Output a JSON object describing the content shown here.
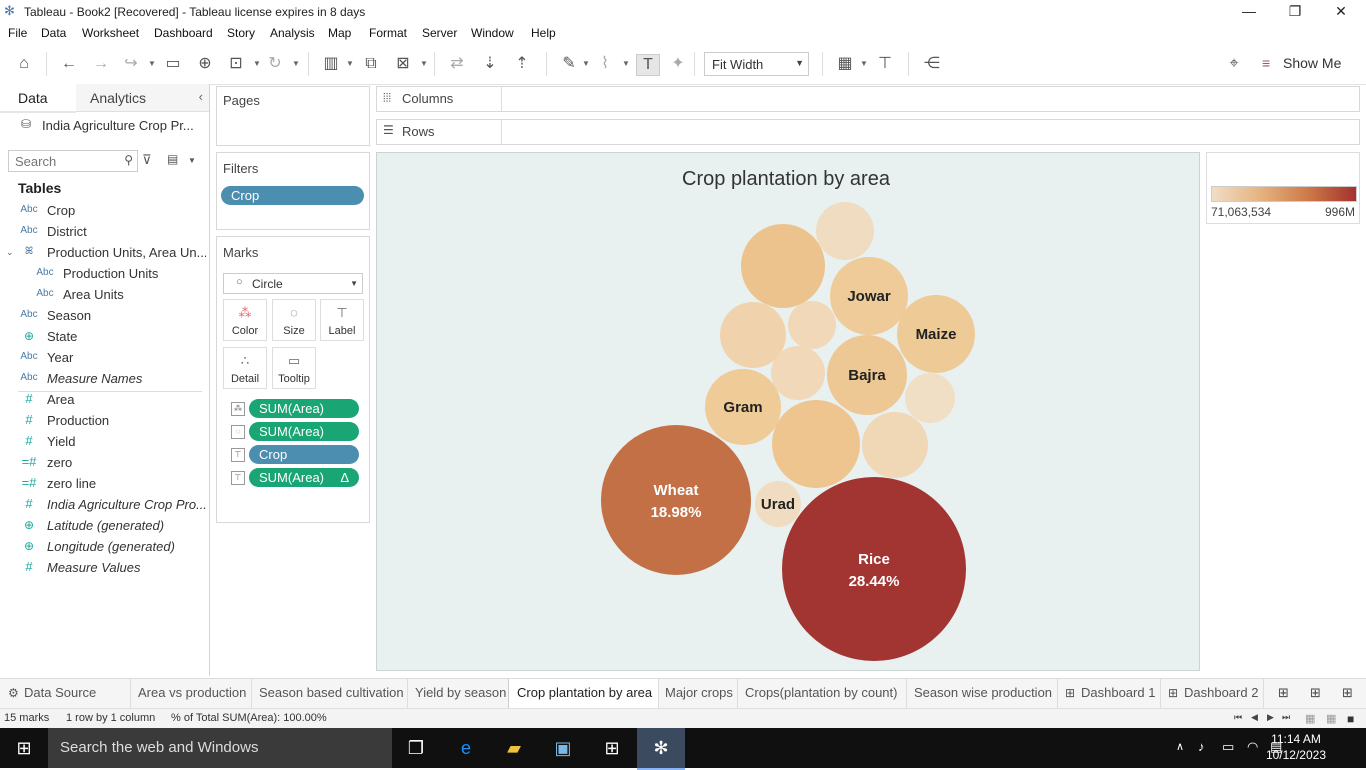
{
  "window": {
    "title": "Tableau - Book2 [Recovered] - Tableau license expires in 8 days",
    "minimize": "—",
    "restore": "❐",
    "close": "✕"
  },
  "menu": [
    "File",
    "Data",
    "Worksheet",
    "Dashboard",
    "Story",
    "Analysis",
    "Map",
    "Format",
    "Server",
    "Window",
    "Help"
  ],
  "toolbar": {
    "fit": "Fit Width",
    "show_me": "Show Me"
  },
  "data_pane": {
    "tab_data": "Data",
    "tab_analytics": "Analytics",
    "datasource": "India Agriculture Crop Pr...",
    "search_placeholder": "Search",
    "tables_heading": "Tables",
    "fields": [
      {
        "type": "Abc",
        "name": "Crop",
        "italic": false,
        "indent": 0
      },
      {
        "type": "Abc",
        "name": "District",
        "italic": false,
        "indent": 0
      },
      {
        "type": "hier",
        "name": "Production Units, Area Un...",
        "italic": false,
        "indent": 0
      },
      {
        "type": "Abc",
        "name": "Production Units",
        "italic": false,
        "indent": 1
      },
      {
        "type": "Abc",
        "name": "Area Units",
        "italic": false,
        "indent": 1
      },
      {
        "type": "Abc",
        "name": "Season",
        "italic": false,
        "indent": 0
      },
      {
        "type": "geo",
        "name": "State",
        "italic": false,
        "indent": 0
      },
      {
        "type": "Abc",
        "name": "Year",
        "italic": false,
        "indent": 0
      },
      {
        "type": "Abc",
        "name": "Measure Names",
        "italic": true,
        "indent": 0
      },
      {
        "type": "#",
        "name": "Area",
        "italic": false,
        "indent": 0
      },
      {
        "type": "#",
        "name": "Production",
        "italic": false,
        "indent": 0
      },
      {
        "type": "#",
        "name": "Yield",
        "italic": false,
        "indent": 0
      },
      {
        "type": "=#",
        "name": "zero",
        "italic": false,
        "indent": 0
      },
      {
        "type": "=#",
        "name": "zero line",
        "italic": false,
        "indent": 0
      },
      {
        "type": "#",
        "name": "India Agriculture Crop Pro...",
        "italic": true,
        "indent": 0
      },
      {
        "type": "geo",
        "name": "Latitude (generated)",
        "italic": true,
        "indent": 0
      },
      {
        "type": "geo",
        "name": "Longitude (generated)",
        "italic": true,
        "indent": 0
      },
      {
        "type": "#",
        "name": "Measure Values",
        "italic": true,
        "indent": 0
      }
    ]
  },
  "shelves": {
    "pages": "Pages",
    "filters": "Filters",
    "filter_pill": "Crop",
    "marks": "Marks",
    "mark_type": "Circle",
    "mark_buttons": [
      "Color",
      "Size",
      "Label",
      "Detail",
      "Tooltip"
    ],
    "mark_pills": [
      {
        "label": "SUM(Area)",
        "kind": "green",
        "delta": ""
      },
      {
        "label": "SUM(Area)",
        "kind": "green",
        "delta": ""
      },
      {
        "label": "Crop",
        "kind": "blue",
        "delta": ""
      },
      {
        "label": "SUM(Area)",
        "kind": "green",
        "delta": "Δ"
      }
    ],
    "columns": "Columns",
    "rows": "Rows"
  },
  "view": {
    "title": "Crop plantation by area",
    "legend_min": "71,063,534",
    "legend_max": "996M",
    "bubbles": [
      {
        "label": "Rice",
        "pct": "28.44%",
        "color": "#a23431",
        "text": "#ffffff"
      },
      {
        "label": "Wheat",
        "pct": "18.98%",
        "color": "#c47046",
        "text": "#ffffff"
      },
      {
        "label": "Gram",
        "pct": "",
        "color": "#efcb98",
        "text": "#222222"
      },
      {
        "label": "Bajra",
        "pct": "",
        "color": "#eec894",
        "text": "#222222"
      },
      {
        "label": "Jowar",
        "pct": "",
        "color": "#eecb99",
        "text": "#222222"
      },
      {
        "label": "Maize",
        "pct": "",
        "color": "#eeca96",
        "text": "#222222"
      },
      {
        "label": "Urad",
        "pct": "",
        "color": "#f0dcc1",
        "text": "#222222"
      },
      {
        "label": "",
        "pct": "",
        "color": "#eec58f",
        "text": "#222222"
      },
      {
        "label": "",
        "pct": "",
        "color": "#ecc38c",
        "text": "#222222"
      },
      {
        "label": "",
        "pct": "",
        "color": "#f0d3ac",
        "text": "#222222"
      },
      {
        "label": "",
        "pct": "",
        "color": "#f0d8b8",
        "text": "#222222"
      },
      {
        "label": "",
        "pct": "",
        "color": "#f0d8b8",
        "text": "#222222"
      },
      {
        "label": "",
        "pct": "",
        "color": "#f0d7b5",
        "text": "#222222"
      },
      {
        "label": "",
        "pct": "",
        "color": "#f0dcc0",
        "text": "#222222"
      },
      {
        "label": "",
        "pct": "",
        "color": "#f0dec5",
        "text": "#222222"
      }
    ]
  },
  "sheet_tabs": [
    {
      "label": "Data Source",
      "icon": "⚙",
      "active": false
    },
    {
      "label": "Area vs production",
      "icon": "",
      "active": false
    },
    {
      "label": "Season based cultivation",
      "icon": "",
      "active": false
    },
    {
      "label": "Yield by season",
      "icon": "",
      "active": false
    },
    {
      "label": "Crop plantation by area",
      "icon": "",
      "active": true
    },
    {
      "label": "Major crops",
      "icon": "",
      "active": false
    },
    {
      "label": "Crops(plantation by count)",
      "icon": "",
      "active": false
    },
    {
      "label": "Season wise production",
      "icon": "",
      "active": false
    },
    {
      "label": "Dashboard 1",
      "icon": "⊞",
      "active": false
    },
    {
      "label": "Dashboard 2",
      "icon": "⊞",
      "active": false
    }
  ],
  "status": {
    "marks": "15 marks",
    "dims": "1 row by 1 column",
    "total": "% of Total SUM(Area): 100.00%"
  },
  "taskbar": {
    "search": "Search the web and Windows",
    "time": "11:14 AM",
    "date": "10/12/2023"
  }
}
